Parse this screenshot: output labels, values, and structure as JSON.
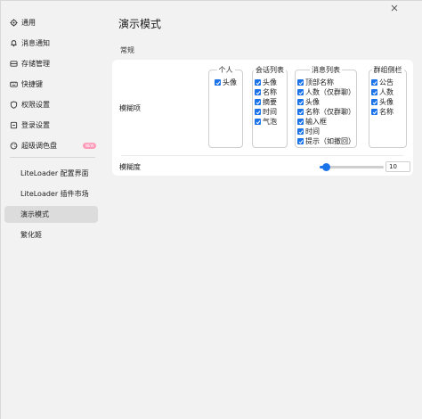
{
  "sidebar": {
    "items": [
      {
        "label": "通用",
        "icon": "gear-icon"
      },
      {
        "label": "消息通知",
        "icon": "bell-icon"
      },
      {
        "label": "存储管理",
        "icon": "storage-icon"
      },
      {
        "label": "快捷键",
        "icon": "keyboard-icon"
      },
      {
        "label": "权限设置",
        "icon": "shield-icon"
      },
      {
        "label": "登录设置",
        "icon": "login-icon"
      },
      {
        "label": "超级调色盘",
        "icon": "palette-icon",
        "badge": "NEW"
      }
    ],
    "plugins": [
      {
        "label": "LiteLoader 配置界面"
      },
      {
        "label": "LiteLoader 插件市场"
      },
      {
        "label": "演示模式",
        "active": true
      },
      {
        "label": "繁化姬"
      }
    ]
  },
  "main": {
    "title": "演示模式",
    "section": "常规",
    "blur_items_label": "模糊项",
    "blur_level_label": "模糊度",
    "blur_level_value": "10",
    "blur_level_fraction": 0.1,
    "groups": [
      {
        "title": "个人",
        "items": [
          "头像"
        ]
      },
      {
        "title": "会话列表",
        "items": [
          "头像",
          "名称",
          "摘要",
          "时间",
          "气泡"
        ]
      },
      {
        "title": "消息列表",
        "items": [
          "顶部名称",
          "人数（仅群聊）",
          "头像",
          "名称（仅群聊）",
          "输入框",
          "时间",
          "提示（如撤回）"
        ]
      },
      {
        "title": "群组侧栏",
        "items": [
          "公告",
          "人数",
          "头像",
          "名称"
        ]
      }
    ]
  },
  "colors": {
    "accent": "#1a73e8",
    "badge": "#ff9bb8",
    "active_item": "#dcdcdc"
  }
}
